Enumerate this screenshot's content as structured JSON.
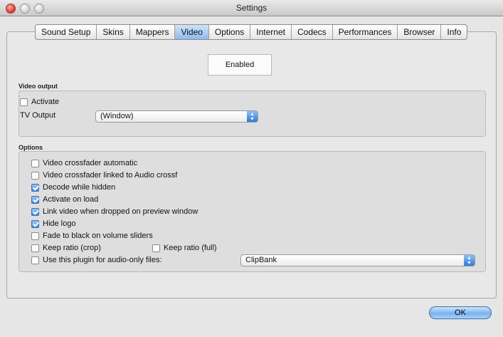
{
  "window": {
    "title": "Settings"
  },
  "tabs": [
    {
      "label": "Sound Setup"
    },
    {
      "label": "Skins"
    },
    {
      "label": "Mappers"
    },
    {
      "label": "Video",
      "active": true
    },
    {
      "label": "Options"
    },
    {
      "label": "Internet"
    },
    {
      "label": "Codecs"
    },
    {
      "label": "Performances"
    },
    {
      "label": "Browser"
    },
    {
      "label": "Info"
    }
  ],
  "enabled_button": {
    "label": "Enabled"
  },
  "video_output": {
    "title": "Video output",
    "activate": {
      "label": "Activate",
      "checked": false
    },
    "tv_output": {
      "label": "TV Output",
      "value": "(Window)"
    }
  },
  "options": {
    "title": "Options",
    "items": [
      {
        "label": "Video crossfader automatic",
        "checked": false
      },
      {
        "label": "Video crossfader linked to Audio crossf",
        "checked": false
      },
      {
        "label": "Decode while hidden",
        "checked": true
      },
      {
        "label": "Activate on load",
        "checked": true
      },
      {
        "label": "Link video when dropped on preview window",
        "checked": true
      },
      {
        "label": "Hide logo",
        "checked": true
      },
      {
        "label": "Fade to black on volume sliders",
        "checked": false
      }
    ],
    "keep_ratio_crop": {
      "label": "Keep ratio (crop)",
      "checked": false
    },
    "keep_ratio_full": {
      "label": "Keep ratio (full)",
      "checked": false
    },
    "audio_only": {
      "label": "Use this plugin for audio-only files:",
      "checked": false,
      "value": "ClipBank"
    }
  },
  "ok_button": {
    "label": "OK"
  },
  "colors": {
    "accent": "#3d88de",
    "tab_active": "#8fb9ee"
  }
}
